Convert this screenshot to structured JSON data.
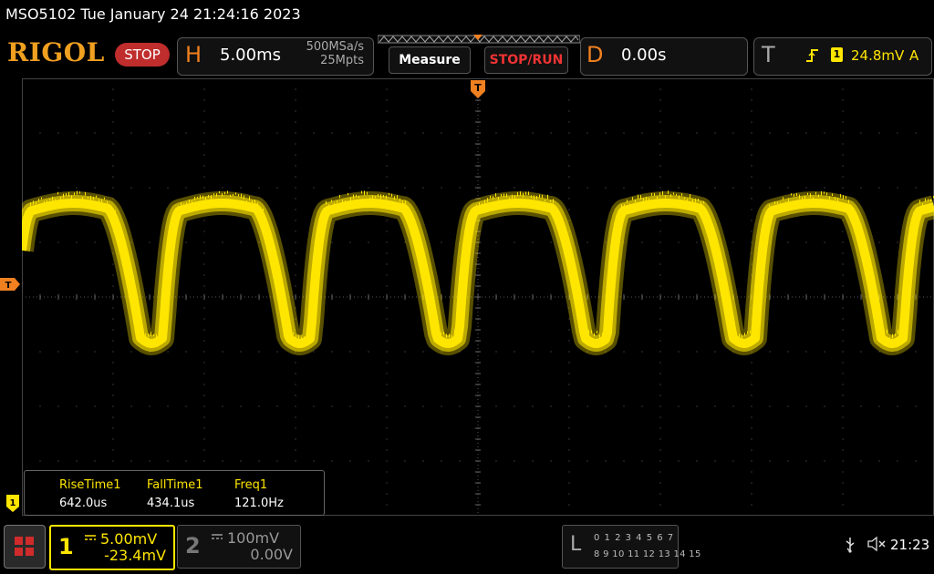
{
  "titlebar": {
    "text": "MSO5102  Tue January 24 21:24:16 2023"
  },
  "logo": "RIGOL",
  "run_state": "STOP",
  "horizontal": {
    "letter": "H",
    "timebase": "5.00ms",
    "sample_rate": "500MSa/s",
    "memory_depth": "25Mpts"
  },
  "buttons": {
    "measure": "Measure",
    "stop_run": "STOP/RUN"
  },
  "delay": {
    "letter": "D",
    "value": "0.00s"
  },
  "trigger": {
    "letter": "T",
    "edge_icon": "rising-edge-icon",
    "source": "1",
    "level": "24.8mV",
    "mode": "A"
  },
  "markers": {
    "trigger_top": "T",
    "trigger_left": "T",
    "ch1_ground": "1"
  },
  "measurements": [
    {
      "name": "RiseTime1",
      "value": "642.0us"
    },
    {
      "name": "FallTime1",
      "value": "434.1us"
    },
    {
      "name": "Freq1",
      "value": "121.0Hz"
    }
  ],
  "channel1": {
    "number": "1",
    "scale": "5.00mV",
    "offset": "-23.4mV",
    "color": "#ffe600"
  },
  "channel2": {
    "number": "2",
    "scale": "100mV",
    "offset": "0.00V"
  },
  "logic": {
    "letter": "L",
    "row1": "0 1 2 3  4 5 6 7",
    "row2": "8 9 10 11 12 13 14 15"
  },
  "status": {
    "clock": "21:23",
    "usb_icon": "usb-icon",
    "speaker_icon": "speaker-muted-icon"
  },
  "colors": {
    "accent": "#f08020",
    "trace": "#ffe600",
    "stop": "#c02d2d"
  }
}
